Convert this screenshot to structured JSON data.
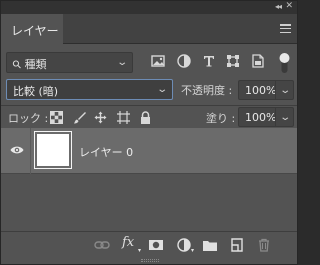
{
  "panel": {
    "tab_label": "レイヤー",
    "collapse_glyph": "◂◂",
    "close_glyph": "✕"
  },
  "filter": {
    "search_glyph": "⚲",
    "kind_label": "種類",
    "icons": [
      "pixel-layer-filter-icon",
      "adjustment-layer-filter-icon",
      "type-layer-filter-icon",
      "shape-layer-filter-icon",
      "smart-object-filter-icon"
    ]
  },
  "blend": {
    "mode": "比較 (暗)",
    "opacity_label": "不透明度 :",
    "opacity_value": "100%",
    "fill_label": "塗り :",
    "fill_value": "100%"
  },
  "lock": {
    "label": "ロック :",
    "icons": [
      "lock-transparent-pixels-icon",
      "lock-image-pixels-icon",
      "lock-position-icon",
      "lock-artboard-icon",
      "lock-all-icon"
    ]
  },
  "layers": [
    {
      "name": "レイヤー 0",
      "visible": true
    }
  ],
  "bottom_toolbar": {
    "fx_label": "fx",
    "icons": [
      "link-layers-icon",
      "layer-style-icon",
      "add-mask-icon",
      "new-adjustment-layer-icon",
      "new-group-icon",
      "new-layer-icon",
      "delete-layer-icon"
    ]
  },
  "colors": {
    "panel_bg": "#535353",
    "selected_layer_bg": "#6b6b6b",
    "focus_border": "#6d8cb5"
  }
}
